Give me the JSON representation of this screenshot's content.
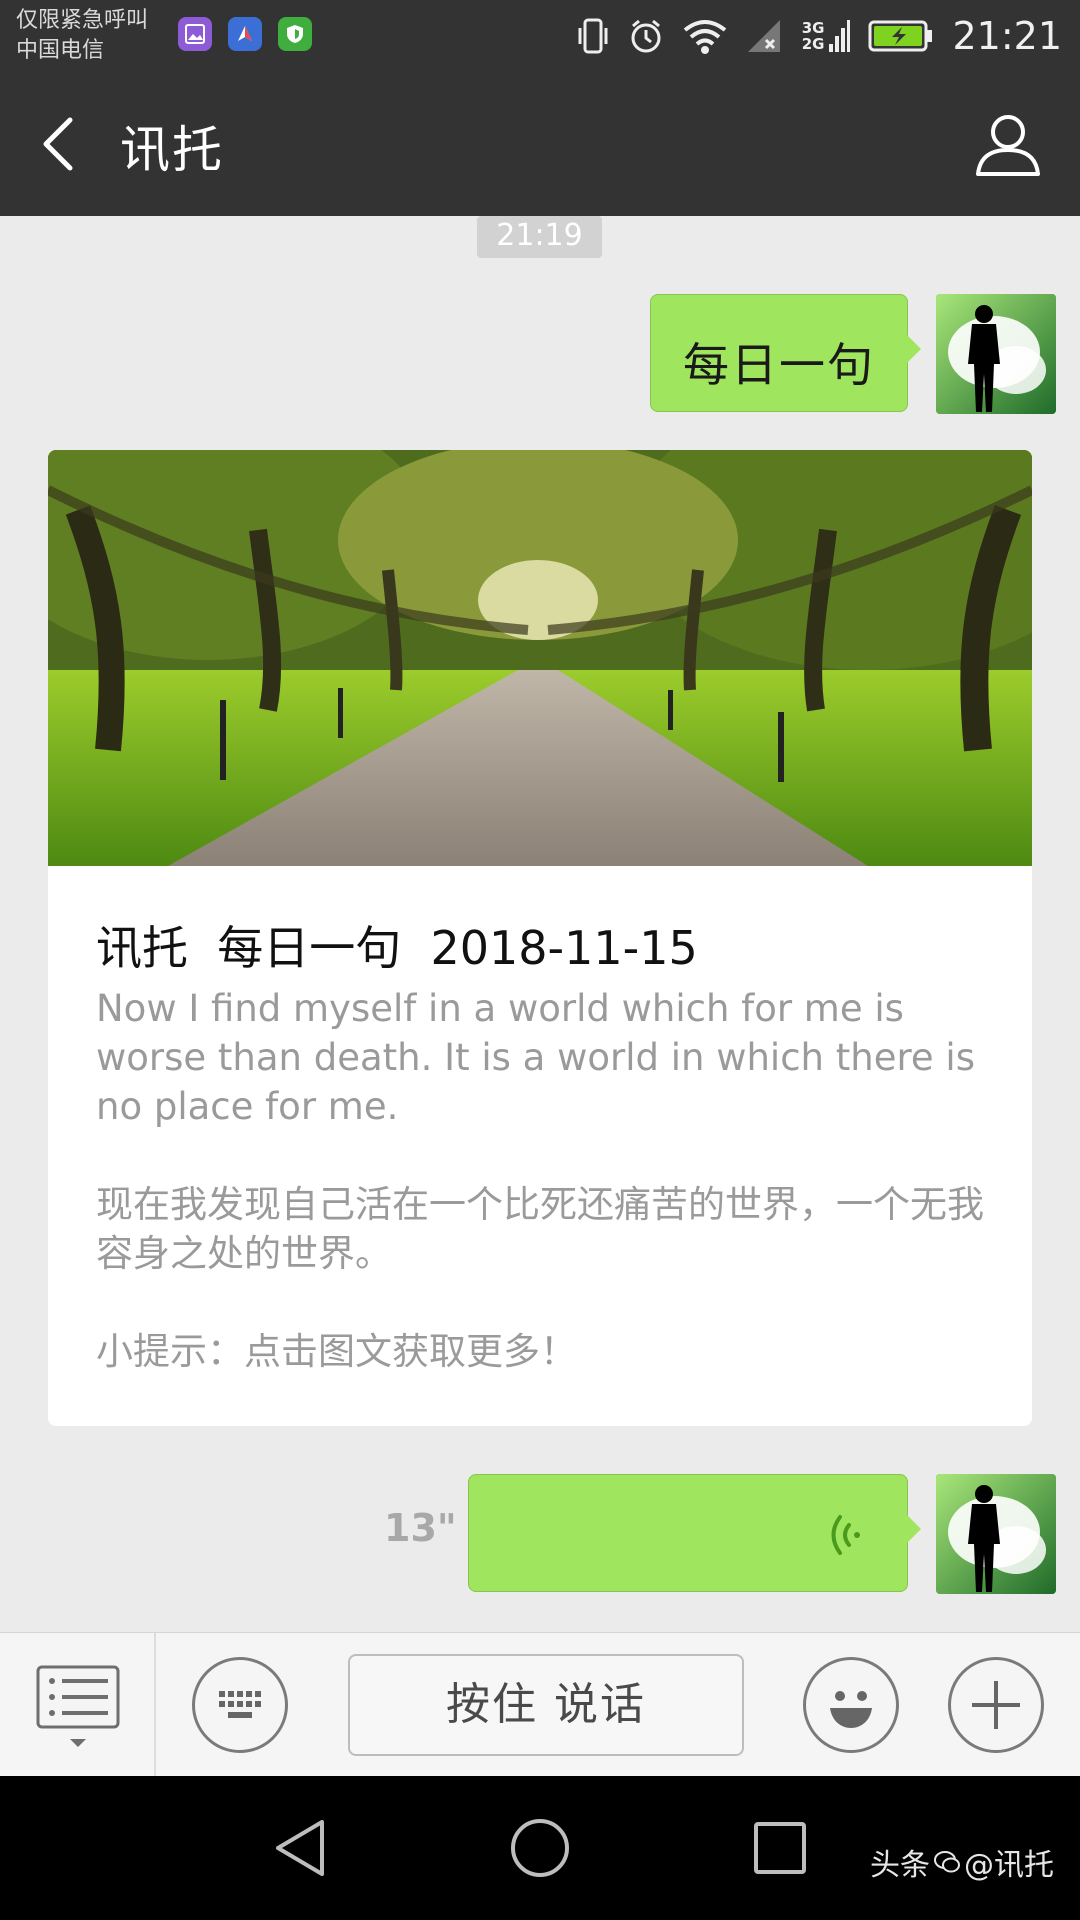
{
  "status_bar": {
    "carrier_line1": "仅限紧急呼叫",
    "carrier_line2": "中国电信",
    "net_3g": "3G",
    "net_2g": "2G",
    "time": "21:21"
  },
  "title_bar": {
    "title": "讯托"
  },
  "chat": {
    "timestamp": "21:19",
    "messages": [
      {
        "type": "text",
        "text": "每日一句"
      },
      {
        "type": "article",
        "title": "讯托  每日一句  2018-11-15",
        "paragraphs": [
          "Now I find myself in a world which for me is worse than death. It is a world in which there is no place for me.",
          "现在我发现自己活在一个比死还痛苦的世界，一个无我容身之处的世界。",
          "小提示：点击图文获取更多！"
        ]
      },
      {
        "type": "voice",
        "duration": "13\""
      }
    ]
  },
  "input_bar": {
    "hold_to_talk": "按住 说话"
  },
  "nav_bar": {
    "watermark_brand": "头条",
    "watermark_handle": "@讯托"
  },
  "colors": {
    "header_bg": "#333333",
    "chat_bg": "#ebebeb",
    "bubble_green": "#9fe65e",
    "text_gray": "#9a9a9a"
  },
  "icons": [
    "back-icon",
    "profile-icon",
    "voice-wave-icon",
    "menu-list-icon",
    "keyboard-icon",
    "emoji-icon",
    "plus-icon",
    "nav-back-icon",
    "nav-home-icon",
    "nav-recent-icon"
  ]
}
